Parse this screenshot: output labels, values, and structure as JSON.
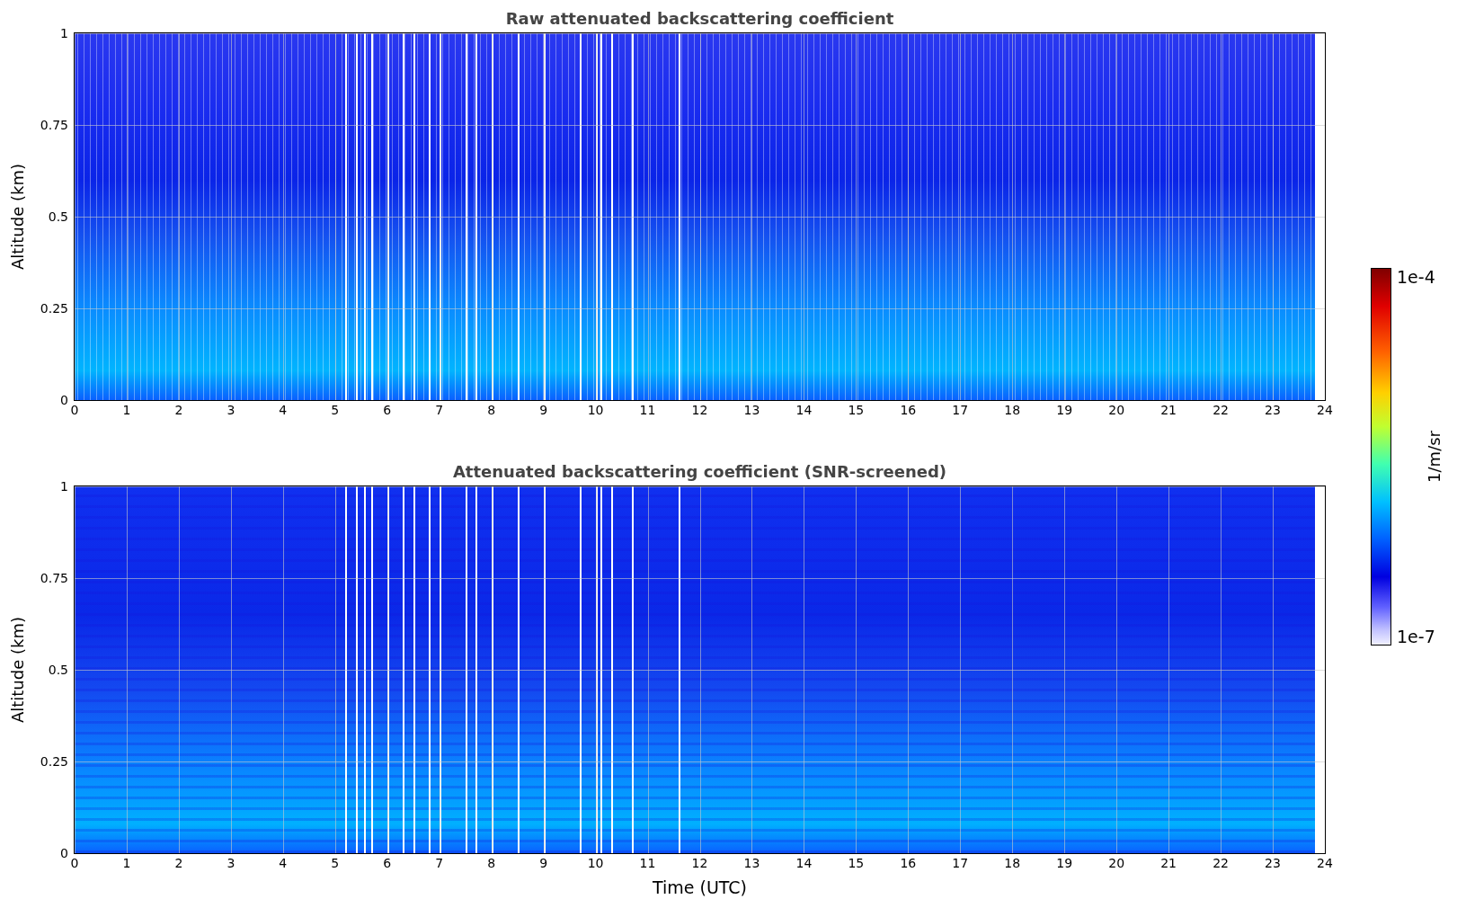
{
  "plots": [
    {
      "kind": "raw",
      "title": "Raw attenuated backscattering coefficient",
      "ylabel": "Altitude (km)",
      "yticks": [
        "1",
        "0.75",
        "0.5",
        "0.25",
        "0"
      ],
      "xticks": [
        "0",
        "1",
        "2",
        "3",
        "4",
        "5",
        "6",
        "7",
        "8",
        "9",
        "10",
        "11",
        "12",
        "13",
        "14",
        "15",
        "16",
        "17",
        "18",
        "19",
        "20",
        "21",
        "22",
        "23",
        "24"
      ]
    },
    {
      "kind": "screened",
      "title": "Attenuated backscattering coefficient (SNR-screened)",
      "ylabel": "Altitude (km)",
      "yticks": [
        "1",
        "0.75",
        "0.5",
        "0.25",
        "0"
      ],
      "xticks": [
        "0",
        "1",
        "2",
        "3",
        "4",
        "5",
        "6",
        "7",
        "8",
        "9",
        "10",
        "11",
        "12",
        "13",
        "14",
        "15",
        "16",
        "17",
        "18",
        "19",
        "20",
        "21",
        "22",
        "23",
        "24"
      ],
      "xlabel": "Time (UTC)"
    }
  ],
  "colorbar": {
    "label": "1/m/sr",
    "max": "1e-4",
    "min": "1e-7"
  }
}
